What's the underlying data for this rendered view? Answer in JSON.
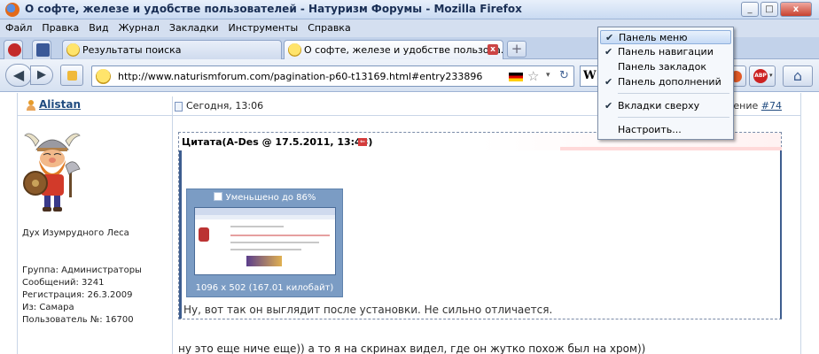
{
  "window": {
    "title": "О софте, железе и удобстве пользователей - Натуризм Форумы - Mozilla Firefox",
    "controls": [
      "_",
      "□",
      "x"
    ]
  },
  "menubar": {
    "items": [
      "Файл",
      "Правка",
      "Вид",
      "Журнал",
      "Закладки",
      "Инструменты",
      "Справка"
    ],
    "accel": [
      "Ф",
      "П",
      "В",
      "Ж",
      "З",
      "И",
      "С"
    ]
  },
  "tabs": {
    "items": [
      {
        "label": "Результаты поиска"
      },
      {
        "label": "О софте, железе и удобстве пользова..."
      }
    ],
    "new_tab": "+",
    "close": "x"
  },
  "navbar": {
    "back": "◀",
    "forward": "▶",
    "url": "http://www.naturismforum.com/pagination-p60-t13169.html#entry233896",
    "star": "☆",
    "dropdown": "▾",
    "reload": "↻",
    "search_engine_letter": "W",
    "abp_label": "ABP",
    "abp_dropdown": "▾",
    "home": "⌂"
  },
  "post": {
    "username": "Alistan",
    "date": "Сегодня, 13:06",
    "postnum_prefix": "ение ",
    "postnum_link": "#74",
    "user_title": "Дух Изумрудного Леса",
    "details": [
      "Группа: Администраторы",
      "Сообщений: 3241",
      "Регистрация: 26.3.2009",
      "Из: Самара",
      "Пользователь №: 16700"
    ],
    "quote": {
      "title": "Цитата(A-Des @ 17.5.2011, 13:43)",
      "arrow": "⇐",
      "thumb_reduced": "Уменьшено до 86%",
      "thumb_dims": "1096 x 502 (167.01 килобайт)",
      "text": "Ну, вот так он выглядит после установки. Не сильно отличается."
    },
    "body": "ну это еще ниче еще)) а то я на скринах видел, где он жутко похож был на хром))"
  },
  "context_menu": {
    "items": [
      {
        "label": "Панель меню",
        "checked": true,
        "highlighted": true
      },
      {
        "label": "Панель навигации",
        "checked": true,
        "highlighted": false
      },
      {
        "label": "Панель закладок",
        "checked": false,
        "highlighted": false
      },
      {
        "label": "Панель дополнений",
        "checked": true,
        "highlighted": false
      },
      {
        "label": "Вкладки сверху",
        "checked": true,
        "highlighted": false
      },
      {
        "label": "Настроить...",
        "checked": false,
        "highlighted": false
      }
    ],
    "check_glyph": "✔"
  },
  "colors": {
    "link": "#1f4a7f",
    "accent_red": "#d43c3c",
    "thumb_bg": "#7b9cc4",
    "titlebar_text": "#1a2f55"
  }
}
